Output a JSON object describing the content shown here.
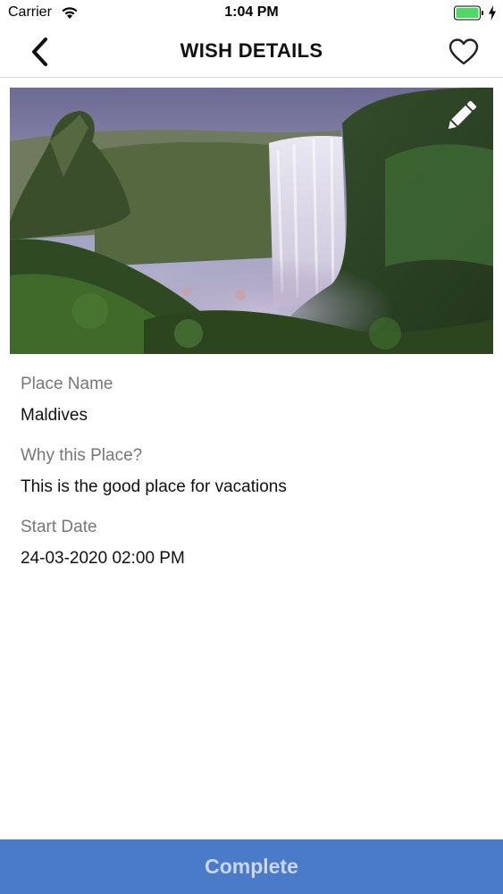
{
  "status_bar": {
    "carrier": "Carrier",
    "time": "1:04 PM",
    "battery_color": "#4cd964"
  },
  "nav": {
    "title": "WISH DETAILS",
    "back_icon": "chevron-left-icon",
    "favorite_icon": "heart-outline-icon"
  },
  "hero": {
    "edit_icon": "pencil-icon"
  },
  "details": {
    "fields": [
      {
        "label": "Place Name",
        "value": "Maldives"
      },
      {
        "label": "Why this Place?",
        "value": "This is the good place for vacations"
      },
      {
        "label": "Start Date",
        "value": "24-03-2020 02:00 PM"
      }
    ]
  },
  "footer": {
    "complete_label": "Complete",
    "accent_color": "#4a7bc9"
  }
}
